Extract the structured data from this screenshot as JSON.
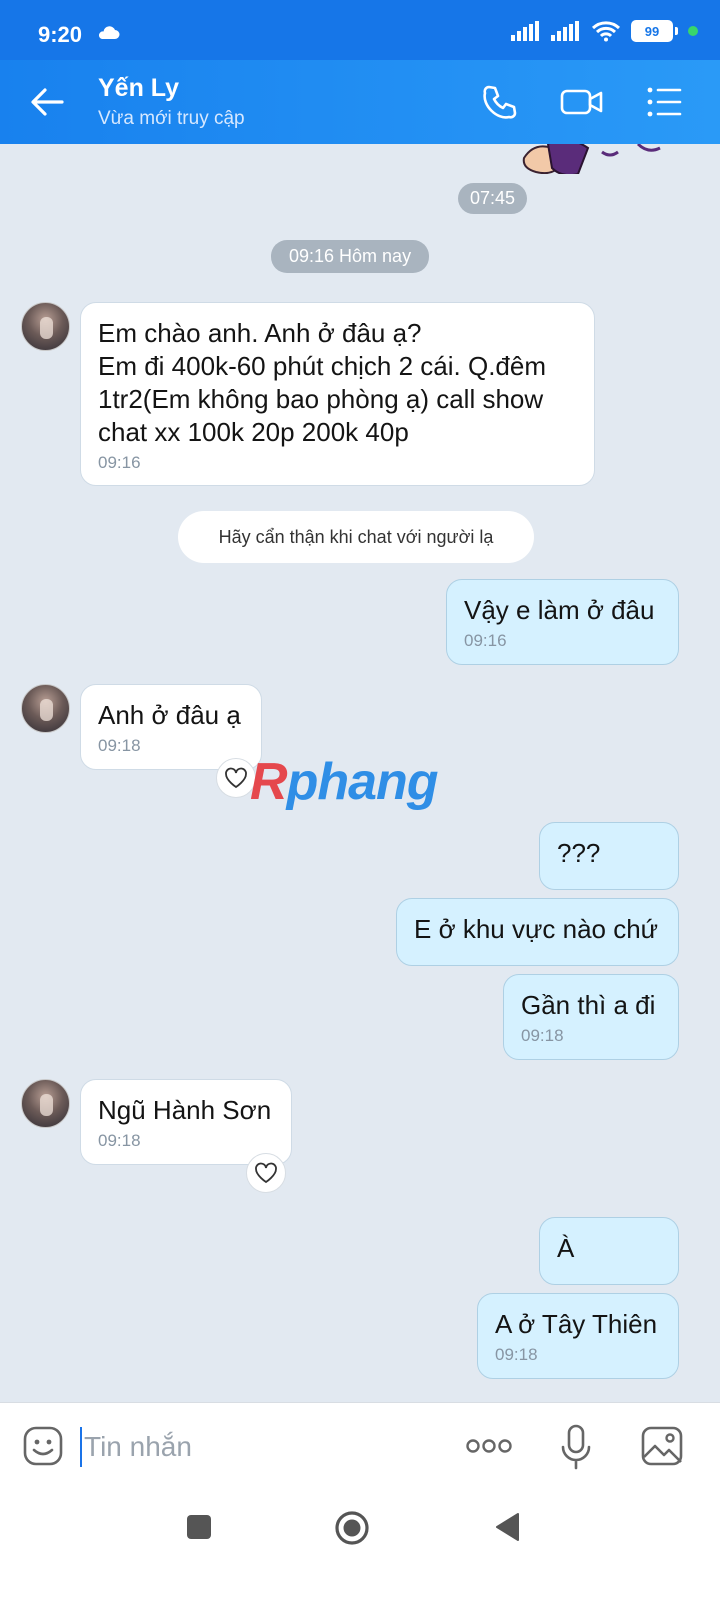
{
  "status_bar": {
    "time": "9:20",
    "battery": "99"
  },
  "header": {
    "contact_name": "Yến Ly",
    "contact_status": "Vừa mới truy cập"
  },
  "chat": {
    "time_top": "07:45",
    "date_separator": "09:16 Hôm nay",
    "notice": "Hãy cẩn thận khi chat với người lạ",
    "messages": [
      {
        "side": "in",
        "lines": [
          "Em chào anh. Anh ở đâu ạ?",
          "Em đi 400k-60 phút chịch 2 cái. Q.đêm",
          "1tr2(Em không bao phòng ạ) call show",
          "chat xx 100k 20p 200k 40p"
        ],
        "time": "09:16"
      },
      {
        "side": "out",
        "text": "Vậy e làm ở đâu",
        "time": "09:16"
      },
      {
        "side": "in",
        "text": "Anh ở đâu ạ",
        "time": "09:18"
      },
      {
        "side": "out",
        "text": "???"
      },
      {
        "side": "out",
        "text": "E ở khu vực nào chứ"
      },
      {
        "side": "out",
        "text": "Gần thì a đi",
        "time": "09:18"
      },
      {
        "side": "in",
        "text": "Ngũ Hành Sơn",
        "time": "09:18"
      },
      {
        "side": "out",
        "text": "À"
      },
      {
        "side": "out",
        "text": "A ở Tây Thiên",
        "time": "09:18"
      }
    ]
  },
  "watermark": {
    "first": "R",
    "rest": "phang"
  },
  "input": {
    "placeholder": "Tin nhắn"
  },
  "colors": {
    "header": "#1881ee",
    "status_bar": "#1676e8",
    "bubble_out": "#d5f1ff",
    "bubble_in": "#ffffff",
    "chat_bg": "#e2e9f1"
  }
}
